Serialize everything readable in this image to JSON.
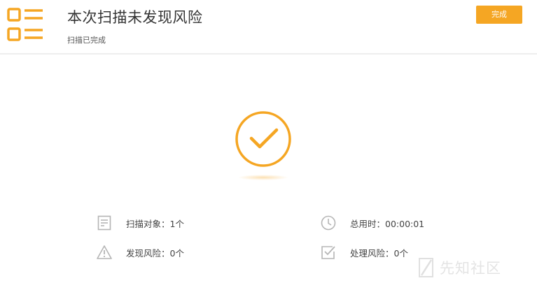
{
  "header": {
    "title": "本次扫描未发现风险",
    "subtitle": "扫描已完成",
    "done_label": "完成",
    "app_icon": "checklist-icon"
  },
  "result": {
    "status_icon": "check-circle-icon"
  },
  "stats": [
    {
      "icon": "document-icon",
      "label": "扫描对象：1个"
    },
    {
      "icon": "clock-icon",
      "label": "总用时：00:00:01"
    },
    {
      "icon": "warning-icon",
      "label": "发现风险：0个"
    },
    {
      "icon": "checkbox-icon",
      "label": "处理风险：0个"
    }
  ],
  "watermark": {
    "text": "先知社区"
  },
  "colors": {
    "accent": "#f5a623",
    "icon_gray": "#b5b5b5",
    "text": "#333333"
  }
}
